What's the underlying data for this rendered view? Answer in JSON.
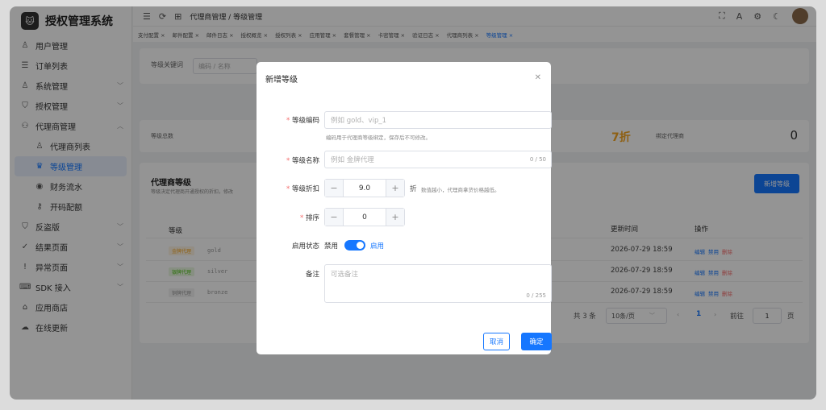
{
  "app": {
    "title": "授权管理系统",
    "logo": "cat-logo"
  },
  "sidebar": {
    "items": [
      {
        "label": "用户管理",
        "icon": "user-icon",
        "arrow": ""
      },
      {
        "label": "订单列表",
        "icon": "list-icon",
        "arrow": ""
      },
      {
        "label": "系统管理",
        "icon": "user-icon",
        "arrow": "﹀"
      },
      {
        "label": "授权管理",
        "icon": "shield-icon",
        "arrow": "﹀"
      },
      {
        "label": "代理商管理",
        "icon": "org-icon",
        "arrow": "︿"
      },
      {
        "label": "代理商列表",
        "icon": "person-icon",
        "arrow": ""
      },
      {
        "label": "等级管理",
        "icon": "crown-icon",
        "arrow": ""
      },
      {
        "label": "财务流水",
        "icon": "coin-icon",
        "arrow": ""
      },
      {
        "label": "开码配额",
        "icon": "key-icon",
        "arrow": ""
      },
      {
        "label": "反盗版",
        "icon": "shield-check-icon",
        "arrow": "﹀"
      },
      {
        "label": "结果页面",
        "icon": "check-circle-icon",
        "arrow": "﹀"
      },
      {
        "label": "异常页面",
        "icon": "warning-icon",
        "arrow": "﹀"
      },
      {
        "label": "SDK 接入",
        "icon": "code-icon",
        "arrow": "﹀"
      },
      {
        "label": "应用商店",
        "icon": "store-icon",
        "arrow": ""
      },
      {
        "label": "在线更新",
        "icon": "cloud-icon",
        "arrow": ""
      }
    ]
  },
  "header": {
    "breadcrumb": "代理商管理 / 等级管理"
  },
  "tabs": [
    "支付配置 ×",
    "邮件配置 ×",
    "邮件日志 ×",
    "授权概览 ×",
    "授权列表 ×",
    "应用管理 ×",
    "套餐管理 ×",
    "卡密管理 ×",
    "验证日志 ×",
    "代理商列表 ×",
    "等级管理 ×"
  ],
  "filter": {
    "label": "等级关键词",
    "placeholder": "编码 / 名称"
  },
  "stats": {
    "total_label": "等级总数",
    "discount": "7折",
    "bound_label": "绑定代理商",
    "bound_value": "0"
  },
  "section": {
    "title": "代理商等级",
    "desc": "等级决定代理商开通授权的折扣，修改",
    "add_button": "新增等级"
  },
  "table": {
    "headers": {
      "level": "等级",
      "updated": "更新时间",
      "actions": "操作"
    },
    "rows": [
      {
        "tag": "金牌代理",
        "code": "gold",
        "tag_color": "#f5a623",
        "updated": "2026-07-29 18:59"
      },
      {
        "tag": "银牌代理",
        "code": "silver",
        "tag_color": "#52c41a",
        "updated": "2026-07-29 18:59"
      },
      {
        "tag": "铜牌代理",
        "code": "bronze",
        "tag_color": "#999999",
        "updated": "2026-07-29 18:59"
      }
    ],
    "actions": {
      "edit": "编辑",
      "disable": "禁用",
      "delete": "删除"
    }
  },
  "pagination": {
    "total": "共 3 条",
    "per_page": "10条/页",
    "current": "1",
    "goto": "前往",
    "goto_value": "1",
    "page_suffix": "页"
  },
  "modal": {
    "title": "新增等级",
    "code_label": "等级编码",
    "code_placeholder": "例如 gold、vip_1",
    "code_hint": "编码用于代理商等级绑定，保存后不可修改。",
    "name_label": "等级名称",
    "name_placeholder": "例如 金牌代理",
    "name_count": "0 / 50",
    "discount_label": "等级折扣",
    "discount_value": "9.0",
    "discount_unit": "折",
    "discount_hint": "数值越小，代理商拿货价格越低。",
    "sort_label": "排序",
    "sort_value": "0",
    "status_label": "启用状态",
    "status_off": "禁用",
    "status_on": "启用",
    "remark_label": "备注",
    "remark_placeholder": "可选备注",
    "remark_count": "0 / 255",
    "cancel": "取消",
    "confirm": "确定"
  }
}
